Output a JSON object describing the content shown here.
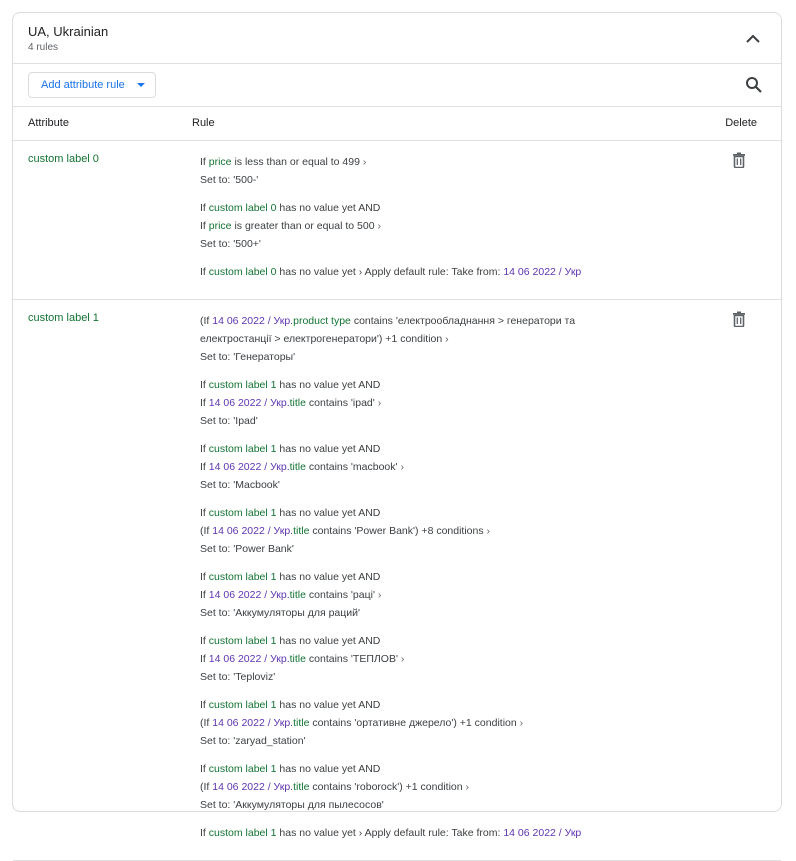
{
  "header": {
    "title": "UA, Ukrainian",
    "subtitle": "4 rules"
  },
  "toolbar": {
    "add_label": "Add attribute rule"
  },
  "columns": {
    "attribute": "Attribute",
    "rule": "Rule",
    "delete": "Delete"
  },
  "icons": {
    "collapse": "chevron-up-icon",
    "search": "search-icon",
    "delete": "trash-icon",
    "dropdown": "caret-down-icon"
  },
  "colors": {
    "accent": "#1a73e8",
    "field": "#137333",
    "source": "#5e35b1",
    "text": "#3c4043",
    "border": "#dadce0"
  },
  "rows": [
    {
      "attribute": "custom label 0",
      "rules": [
        [
          [
            [
              "t",
              "If "
            ],
            [
              "g",
              "price"
            ],
            [
              "t",
              " is less than or equal to 499 "
            ],
            [
              "a",
              "›"
            ]
          ],
          [
            [
              "t",
              "Set to: '500-'"
            ]
          ]
        ],
        [
          [
            [
              "t",
              "If "
            ],
            [
              "g",
              "custom label 0"
            ],
            [
              "t",
              " has no value yet AND"
            ]
          ],
          [
            [
              "t",
              "If "
            ],
            [
              "g",
              "price"
            ],
            [
              "t",
              " is greater than or equal to 500 "
            ],
            [
              "a",
              "›"
            ]
          ],
          [
            [
              "t",
              "Set to: '500+'"
            ]
          ]
        ],
        [
          [
            [
              "t",
              "If "
            ],
            [
              "g",
              "custom label 0"
            ],
            [
              "t",
              " has no value yet › Apply default rule: Take from: "
            ],
            [
              "p",
              "14 06 2022 / Укр"
            ]
          ]
        ]
      ]
    },
    {
      "attribute": "custom label 1",
      "rules": [
        [
          [
            [
              "t",
              "(If "
            ],
            [
              "p",
              "14 06 2022 / Укр."
            ],
            [
              "g",
              "product type"
            ],
            [
              "t",
              " contains 'електрообладнання > генератори та електростанції > електрогенератори') +1 condition "
            ],
            [
              "a",
              "›"
            ]
          ],
          [
            [
              "t",
              "Set to: 'Генераторы'"
            ]
          ]
        ],
        [
          [
            [
              "t",
              "If "
            ],
            [
              "g",
              "custom label 1"
            ],
            [
              "t",
              " has no value yet AND"
            ]
          ],
          [
            [
              "t",
              "If "
            ],
            [
              "p",
              "14 06 2022 / Укр."
            ],
            [
              "g",
              "title"
            ],
            [
              "t",
              " contains 'ipad' "
            ],
            [
              "a",
              "›"
            ]
          ],
          [
            [
              "t",
              "Set to: 'Ipad'"
            ]
          ]
        ],
        [
          [
            [
              "t",
              "If "
            ],
            [
              "g",
              "custom label 1"
            ],
            [
              "t",
              " has no value yet AND"
            ]
          ],
          [
            [
              "t",
              "If "
            ],
            [
              "p",
              "14 06 2022 / Укр."
            ],
            [
              "g",
              "title"
            ],
            [
              "t",
              " contains 'macbook' "
            ],
            [
              "a",
              "›"
            ]
          ],
          [
            [
              "t",
              "Set to: 'Macbook'"
            ]
          ]
        ],
        [
          [
            [
              "t",
              "If "
            ],
            [
              "g",
              "custom label 1"
            ],
            [
              "t",
              " has no value yet AND"
            ]
          ],
          [
            [
              "t",
              "(If "
            ],
            [
              "p",
              "14 06 2022 / Укр."
            ],
            [
              "g",
              "title"
            ],
            [
              "t",
              " contains 'Power Bank') +8 conditions "
            ],
            [
              "a",
              "›"
            ]
          ],
          [
            [
              "t",
              "Set to: 'Power Bank'"
            ]
          ]
        ],
        [
          [
            [
              "t",
              "If "
            ],
            [
              "g",
              "custom label 1"
            ],
            [
              "t",
              " has no value yet AND"
            ]
          ],
          [
            [
              "t",
              "If "
            ],
            [
              "p",
              "14 06 2022 / Укр."
            ],
            [
              "g",
              "title"
            ],
            [
              "t",
              " contains 'раці' "
            ],
            [
              "a",
              "›"
            ]
          ],
          [
            [
              "t",
              "Set to: 'Аккумуляторы для раций'"
            ]
          ]
        ],
        [
          [
            [
              "t",
              "If "
            ],
            [
              "g",
              "custom label 1"
            ],
            [
              "t",
              " has no value yet AND"
            ]
          ],
          [
            [
              "t",
              "If "
            ],
            [
              "p",
              "14 06 2022 / Укр."
            ],
            [
              "g",
              "title"
            ],
            [
              "t",
              " contains 'ТЕПЛОВ' "
            ],
            [
              "a",
              "›"
            ]
          ],
          [
            [
              "t",
              "Set to: 'Teploviz'"
            ]
          ]
        ],
        [
          [
            [
              "t",
              "If "
            ],
            [
              "g",
              "custom label 1"
            ],
            [
              "t",
              " has no value yet AND"
            ]
          ],
          [
            [
              "t",
              "(If "
            ],
            [
              "p",
              "14 06 2022 / Укр."
            ],
            [
              "g",
              "title"
            ],
            [
              "t",
              " contains 'ортативне джерело') +1 condition "
            ],
            [
              "a",
              "›"
            ]
          ],
          [
            [
              "t",
              "Set to: 'zaryad_station'"
            ]
          ]
        ],
        [
          [
            [
              "t",
              "If "
            ],
            [
              "g",
              "custom label 1"
            ],
            [
              "t",
              " has no value yet AND"
            ]
          ],
          [
            [
              "t",
              "(If "
            ],
            [
              "p",
              "14 06 2022 / Укр."
            ],
            [
              "g",
              "title"
            ],
            [
              "t",
              " contains 'roborock') +1 condition "
            ],
            [
              "a",
              "›"
            ]
          ],
          [
            [
              "t",
              "Set to: 'Аккумуляторы для пылесосов'"
            ]
          ]
        ],
        [
          [
            [
              "t",
              "If "
            ],
            [
              "g",
              "custom label 1"
            ],
            [
              "t",
              " has no value yet › Apply default rule: Take from: "
            ],
            [
              "p",
              "14 06 2022 / Укр"
            ]
          ]
        ]
      ]
    }
  ]
}
